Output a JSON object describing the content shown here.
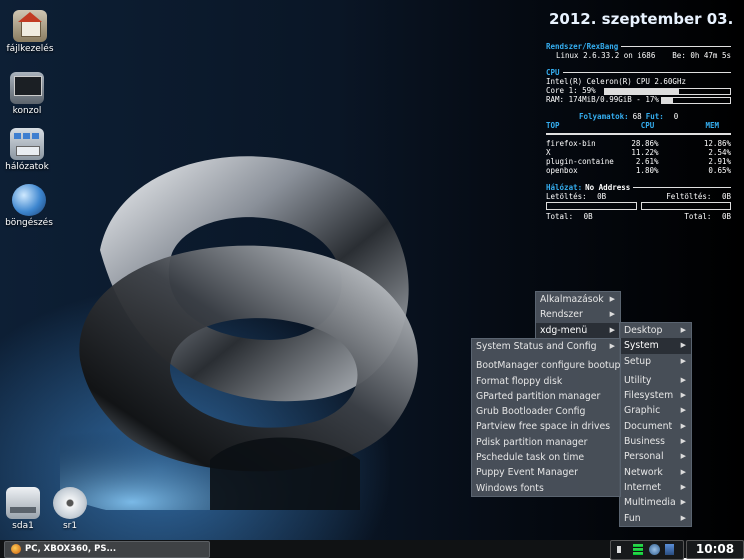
{
  "desktop_icons": [
    {
      "label": "fájlkezelés",
      "icon": "home-folder-icon"
    },
    {
      "label": "konzol",
      "icon": "terminal-icon"
    },
    {
      "label": "hálózatok",
      "icon": "network-icon"
    },
    {
      "label": "böngészés",
      "icon": "globe-icon"
    },
    {
      "label": "sda1",
      "icon": "drive-icon"
    },
    {
      "label": "sr1",
      "icon": "cdrom-icon"
    }
  ],
  "conky": {
    "date": "2012. szeptember 03.",
    "system_header": "Rendszer/RexBang",
    "kernel": "Linux 2.6.33.2 on i686",
    "uptime": "Be: 0h 47m 5s",
    "cpu_header": "CPU",
    "cpu_model": "Intel(R) Celeron(R) CPU 2.60GHz",
    "core1": "Core 1: 59%",
    "core1_percent": 59,
    "ram": "RAM: 174MiB/0.99GiB - 17%",
    "ram_percent": 17,
    "processes_label": "Folyamatok:",
    "processes_count": "68",
    "running_label": "Fut:",
    "running_count": "0",
    "top_headers": [
      "TOP",
      "CPU",
      "MEM"
    ],
    "top_rows": [
      {
        "name": "firefox-bin",
        "cpu": "28.86%",
        "mem": "12.86%"
      },
      {
        "name": "X",
        "cpu": "11.22%",
        "mem": "2.54%"
      },
      {
        "name": "plugin-containe",
        "cpu": "2.61%",
        "mem": "2.91%"
      },
      {
        "name": "openbox",
        "cpu": "1.80%",
        "mem": "0.65%"
      }
    ],
    "network_label": "Hálózat:",
    "network_value": "No Address",
    "download_label": "Letöltés:",
    "download_value": "0B",
    "upload_label": "Feltöltés:",
    "upload_value": "0B",
    "total_label": "Total:",
    "total_down": "0B",
    "total_up": "0B"
  },
  "menus": {
    "root": [
      "Alkalmazások",
      "Rendszer",
      "xdg-menü"
    ],
    "xdg": [
      "Desktop",
      "System",
      "Setup",
      "Utility",
      "Filesystem",
      "Graphic",
      "Document",
      "Business",
      "Personal",
      "Network",
      "Internet",
      "Multimedia",
      "Fun"
    ],
    "system": [
      "System Status and Config",
      "BootManager configure bootup",
      "Format floppy disk",
      "GParted partition manager",
      "Grub Bootloader Config",
      "Partview free space in drives",
      "Pdisk partition manager",
      "Pschedule task on time",
      "Puppy Event Manager",
      "Windows fonts"
    ]
  },
  "taskbar": {
    "task_label": "PC, XBOX360, PS...",
    "clock": "10:08"
  },
  "colors": {
    "accent": "#35aef0",
    "menu_bg": "#4c545e",
    "menu_selected": "#2a2f36"
  }
}
